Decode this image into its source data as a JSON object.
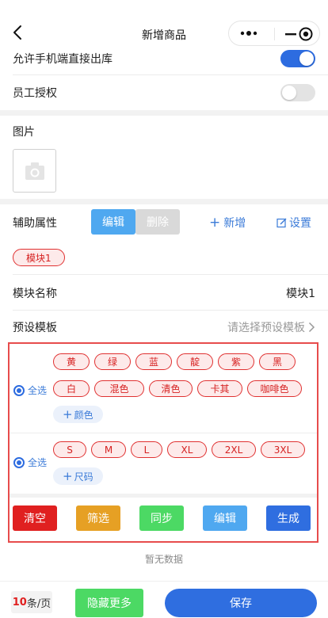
{
  "header": {
    "title": "新增商品"
  },
  "settings": {
    "allow_mobile_outbound_label": "允许手机端直接出库",
    "allow_mobile_outbound_on": true,
    "staff_auth_label": "员工授权",
    "staff_auth_on": false
  },
  "image": {
    "label": "图片"
  },
  "aux_attrs": {
    "label": "辅助属性",
    "edit_label": "编辑",
    "delete_label": "删除",
    "add_label": "新增",
    "settings_label": "设置",
    "module_tag": "模块1"
  },
  "module": {
    "name_label": "模块名称",
    "name_value": "模块1",
    "preset_label": "预设模板",
    "preset_placeholder": "请选择预设模板"
  },
  "colors": {
    "select_all_label": "全选",
    "row1": [
      "黄",
      "绿",
      "蓝",
      "靛",
      "紫",
      "黑"
    ],
    "row2": [
      "白",
      "混色",
      "清色",
      "卡其",
      "咖啡色"
    ],
    "add_label": "颜色"
  },
  "sizes": {
    "select_all_label": "全选",
    "items": [
      "S",
      "M",
      "L",
      "XL",
      "2XL",
      "3XL"
    ],
    "add_label": "尺码"
  },
  "actions": {
    "clear_label": "清空",
    "filter_label": "筛选",
    "sync_label": "同步",
    "edit_label": "编辑",
    "generate_label": "生成"
  },
  "empty_text": "暂无数据",
  "footer": {
    "per_page_num": "10",
    "per_page_unit": "条/页",
    "hide_more_label": "隐藏更多",
    "save_label": "保存"
  },
  "theme": {
    "accent": "#2d6ce0",
    "chip_border": "#e03131",
    "clear": "#e02020",
    "filter": "#e6a024",
    "sync": "#4cd964",
    "edit": "#4fa8f0",
    "generate": "#2f6ee0"
  }
}
